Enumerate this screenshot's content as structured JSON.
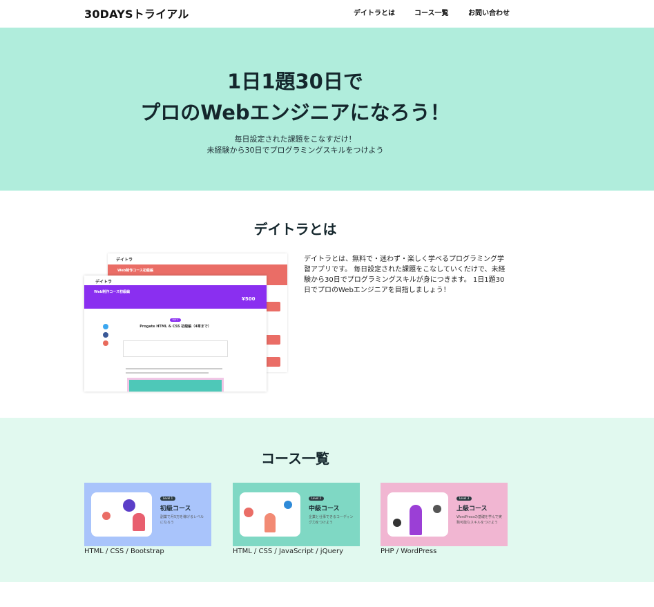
{
  "header": {
    "logo": "30DAYSトライアル",
    "nav": [
      "デイトラとは",
      "コース一覧",
      "お問い合わせ"
    ]
  },
  "hero": {
    "title_line1": "1日1題30日で",
    "title_line2": "プロのWebエンジニアになろう！",
    "sub_line1": "毎日設定された課題をこなすだけ！",
    "sub_line2": "未経験から30日でプログラミングスキルをつけよう"
  },
  "about": {
    "title": "デイトラとは",
    "text": "デイトラとは、無料で・迷わず・楽しく学べるプログラミング学習アプリです。 毎日設定された課題をこなしていくだけで、未経験から30日でプログラミングスキルが身につきます。 1日1題30日でプロのWebエンジニアを目指しましょう！",
    "screenshot": {
      "back_brand": "デイトラ",
      "back_banner": "Web制作コース初級編",
      "front_brand": "デイトラ",
      "front_banner": "Web制作コース初級編",
      "price": "¥500",
      "day_badge": "DAY 1",
      "lesson_title": "Progate HTML & CSS 初級編（4章まで）"
    }
  },
  "courses": {
    "title": "コース一覧",
    "items": [
      {
        "level": "Level 1",
        "name": "初級コース",
        "desc": "副業で月5万を稼げるレベルになろう",
        "tags": "HTML / CSS / Bootstrap",
        "bg": "#a9c4fb"
      },
      {
        "level": "Level 2",
        "name": "中級コース",
        "desc": "企業と仕事できるコーディング力をつけよう",
        "tags": "HTML / CSS / JavaScript / jQuery",
        "bg": "#7fd8c4"
      },
      {
        "level": "Level 3",
        "name": "上級コース",
        "desc": "WordPressの基礎を学んで実務可能なスキルをつけよう",
        "tags": "PHP / WordPress",
        "bg": "#f1b6d2"
      }
    ]
  },
  "colors": {
    "hero_bg": "#b0eddc",
    "courses_bg": "#e1f9ef",
    "accent_purple": "#8a2ff0",
    "accent_red": "#ea6d66"
  }
}
